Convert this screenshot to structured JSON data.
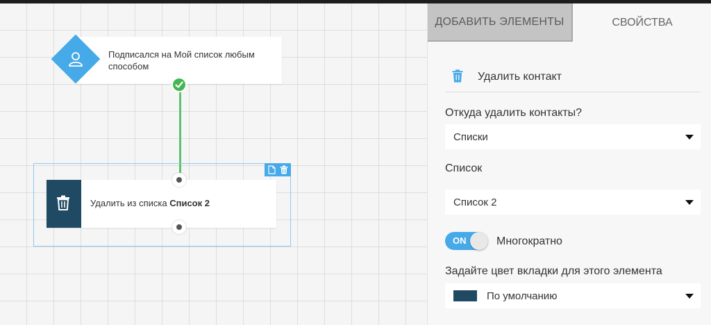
{
  "canvas": {
    "trigger": {
      "text": "Подписался на Мой список любым способом",
      "icon": "user-icon",
      "status_icon": "check-icon"
    },
    "action": {
      "text_prefix": "Удалить из списка",
      "text_bold": "Список 2",
      "icon": "trash-icon",
      "tools": [
        "copy-icon",
        "trash-icon"
      ]
    }
  },
  "panel": {
    "tabs": [
      {
        "label": "ДОБАВИТЬ ЭЛЕМЕНТЫ",
        "active": false
      },
      {
        "label": "СВОЙСТВА",
        "active": true
      }
    ],
    "section": {
      "title": "Удалить контакт",
      "icon": "trash-icon"
    },
    "source_label": "Откуда удалить контакты?",
    "source_value": "Списки",
    "list_label": "Список",
    "list_value": "Список 2",
    "toggle": {
      "state": "ON",
      "label": "Многократно"
    },
    "color_label": "Задайте цвет вкладки для этого элемента",
    "color_value": "По умолчанию"
  },
  "colors": {
    "accent": "#46a9e8",
    "dark_node": "#204a63",
    "success": "#43b653"
  }
}
